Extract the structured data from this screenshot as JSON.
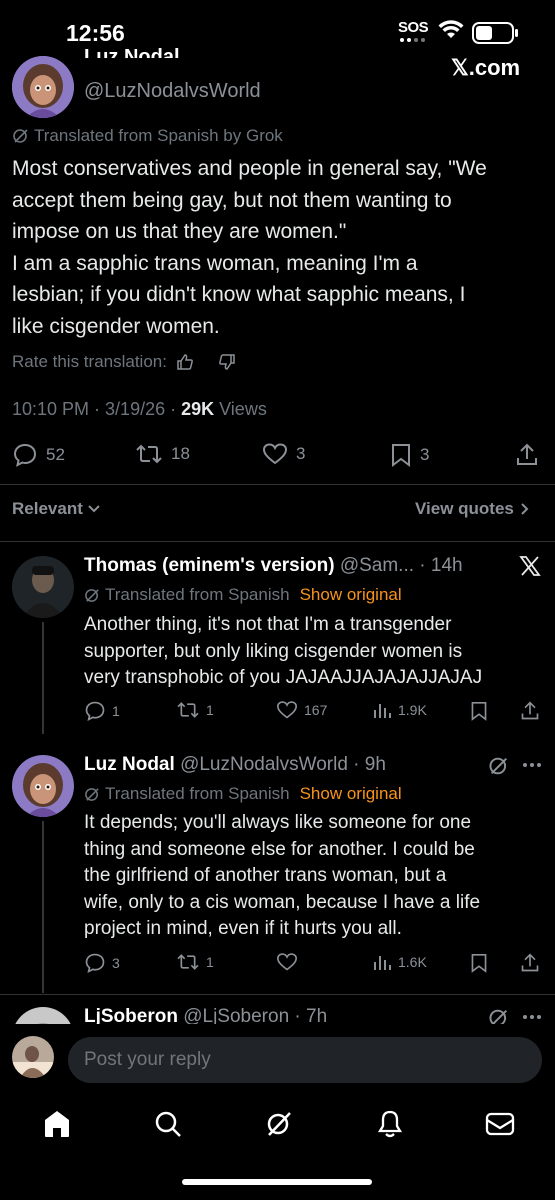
{
  "status": {
    "time": "12:56",
    "sos": "SOS"
  },
  "post": {
    "author_name": "Luz Nodal",
    "author_handle": "@LuzNodalvsWorld",
    "site": "𝕏.com",
    "translated_label": "Translated from Spanish by Grok",
    "body_lines": [
      "Most conservatives and people in general say, \"We",
      "accept them being gay, but not them wanting to",
      "impose on us that they are women.\"",
      "I am a sapphic trans woman, meaning I'm a",
      "lesbian; if you didn't know what sapphic means, I",
      "like cisgender women."
    ],
    "rate_label": "Rate this translation:",
    "timestamp": "10:10 PM · 3/19/26 · ",
    "views_count": "29K",
    "views_label": " Views",
    "replies": "52",
    "reposts": "18",
    "likes": "3",
    "bookmarks": "3"
  },
  "filter": {
    "relevant": "Relevant",
    "view_quotes": "View quotes"
  },
  "replies": [
    {
      "name": "Thomas (eminem's version)",
      "handle": "@Sam... · 14h",
      "translated": "Translated from Spanish",
      "show_original": "Show original",
      "body_lines": [
        "Another thing, it's not that I'm a transgender",
        "supporter, but only liking cisgender women is",
        "very transphobic of you JAJAAJJAJAJAJJAJAJ"
      ],
      "replies": "1",
      "reposts": "1",
      "likes": "167",
      "views": "1.9K"
    },
    {
      "name": "Luz Nodal",
      "handle": "@LuzNodalvsWorld · 9h",
      "translated": "Translated from Spanish",
      "show_original": "Show original",
      "body_lines": [
        "It depends; you'll always like someone for one",
        "thing and someone else for another. I could be",
        "the girlfriend of another trans woman, but a",
        "wife, only to a cis woman, because I have a life",
        "project in mind, even if it hurts you all."
      ],
      "replies": "3",
      "reposts": "1",
      "likes": "",
      "views": "1.6K"
    },
    {
      "name": "LjSoberon",
      "handle": "@LjSoberon · 7h"
    }
  ],
  "compose": {
    "placeholder": "Post your reply"
  },
  "icons": {
    "nav": [
      "home-icon",
      "search-icon",
      "grok-icon",
      "notifications-icon",
      "messages-icon"
    ]
  },
  "colors": {
    "accent_orange": "#f7931a",
    "muted": "#6e767d",
    "background": "#000000"
  }
}
